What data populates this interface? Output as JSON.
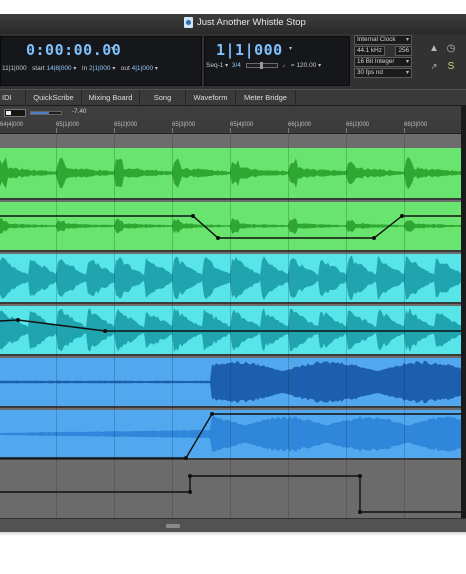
{
  "window": {
    "title": "Just Another Whistle Stop"
  },
  "transport": {
    "main_counter": "0:00:00.00",
    "start_value": "11|1|000",
    "start_label": "start",
    "start_bars": "14|8|000",
    "in_label": "In",
    "in_value": "2|1|000",
    "out_label": "out",
    "out_value": "4|1|000",
    "sub_counter": "1|1|000",
    "sequence": "Seq-1",
    "meter_top": "3",
    "meter_bottom": "4",
    "tempo": "120.00",
    "clock_source": "Internal Clock",
    "sample_rate": "44.1 kHz",
    "buffer": "256",
    "bit_depth": "16 Bit Integer",
    "frame_rate": "30 fps nd"
  },
  "tabs": [
    {
      "label": "IDI"
    },
    {
      "label": "QuickScribe"
    },
    {
      "label": "Mixing Board"
    },
    {
      "label": "Song"
    },
    {
      "label": "Waveform"
    },
    {
      "label": "Meter Bridge"
    }
  ],
  "level": {
    "gain_readout": "-7.40"
  },
  "ruler": {
    "ticks": [
      "64|4|000",
      "65|1|000",
      "65|2|000",
      "65|3|000",
      "65|4|000",
      "66|1|000",
      "66|2|000",
      "66|3|000"
    ]
  },
  "tracks": [
    {
      "name": "green-clip-1",
      "color": "#69e56f",
      "wave_color": "#2fa832",
      "automation": "none"
    },
    {
      "name": "green-clip-2",
      "color": "#69e56f",
      "wave_color": "#2fa832",
      "automation": "dip"
    },
    {
      "name": "cyan-clip-1",
      "color": "#57e5ea",
      "wave_color": "#1fa4b0",
      "automation": "none"
    },
    {
      "name": "cyan-clip-2",
      "color": "#57e5ea",
      "wave_color": "#1fa4b0",
      "automation": "ramp-down"
    },
    {
      "name": "blue-clip-1",
      "color": "#52a8ee",
      "wave_color": "#1c5fae",
      "automation": "none"
    },
    {
      "name": "blue-clip-2",
      "color": "#52a8ee",
      "wave_color": "#1c5fae",
      "automation": "ramp-up"
    },
    {
      "name": "empty-lane",
      "color": "#6b6b6b",
      "automation": "step"
    }
  ],
  "icons": [
    "document-icon",
    "metronome-icon",
    "clock-icon",
    "link-icon",
    "sync-icon",
    "meter-icon",
    "fader-icon",
    "note-icon"
  ],
  "colors": {
    "accent_blue": "#7fc1ff",
    "green_clip": "#69e56f",
    "cyan_clip": "#57e5ea",
    "blue_clip": "#52a8ee"
  }
}
